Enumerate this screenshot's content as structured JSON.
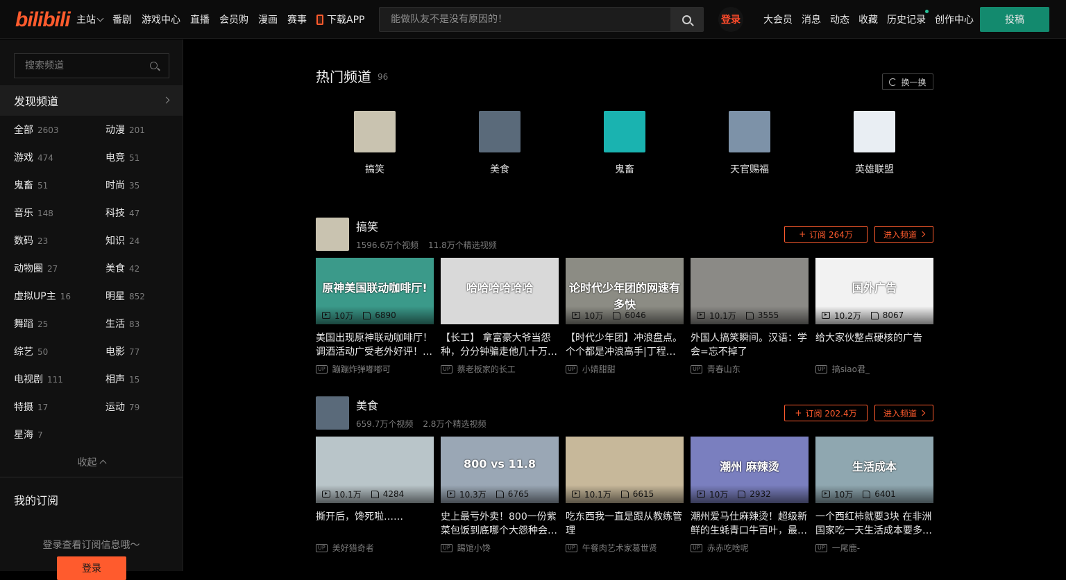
{
  "header": {
    "logo": "bilibili",
    "nav": [
      "主站",
      "番剧",
      "游戏中心",
      "直播",
      "会员购",
      "漫画",
      "赛事",
      "下载APP"
    ],
    "search_placeholder": "能做队友不是没有原因的！",
    "login": "登录",
    "right_nav": [
      "大会员",
      "消息",
      "动态",
      "收藏",
      "历史记录",
      "创作中心"
    ],
    "upload": "投稿"
  },
  "sidebar": {
    "search_placeholder": "搜索频道",
    "discover": "发现频道",
    "categories": [
      {
        "name": "全部",
        "count": "2603"
      },
      {
        "name": "动漫",
        "count": "201"
      },
      {
        "name": "游戏",
        "count": "474"
      },
      {
        "name": "电竞",
        "count": "51"
      },
      {
        "name": "鬼畜",
        "count": "51"
      },
      {
        "name": "时尚",
        "count": "35"
      },
      {
        "name": "音乐",
        "count": "148"
      },
      {
        "name": "科技",
        "count": "47"
      },
      {
        "name": "数码",
        "count": "23"
      },
      {
        "name": "知识",
        "count": "24"
      },
      {
        "name": "动物圈",
        "count": "27"
      },
      {
        "name": "美食",
        "count": "42"
      },
      {
        "name": "虚拟UP主",
        "count": "16"
      },
      {
        "name": "明星",
        "count": "852"
      },
      {
        "name": "舞蹈",
        "count": "25"
      },
      {
        "name": "生活",
        "count": "83"
      },
      {
        "name": "综艺",
        "count": "50"
      },
      {
        "name": "电影",
        "count": "77"
      },
      {
        "name": "电视剧",
        "count": "111"
      },
      {
        "name": "相声",
        "count": "15"
      },
      {
        "name": "特摄",
        "count": "17"
      },
      {
        "name": "运动",
        "count": "79"
      },
      {
        "name": "星海",
        "count": "7"
      }
    ],
    "collapse": "收起",
    "my_subscriptions": "我的订阅",
    "login_tip": "登录查看订阅信息哦～",
    "login_button": "登录"
  },
  "hot": {
    "title": "热门频道",
    "count": "96",
    "refresh": "换一换",
    "channels": [
      {
        "name": "搞笑",
        "color": "#c9c3b0"
      },
      {
        "name": "美食",
        "color": "#5a6a7a"
      },
      {
        "name": "鬼畜",
        "color": "#1ab3b0"
      },
      {
        "name": "天官赐福",
        "color": "#7d92a8"
      },
      {
        "name": "英雄联盟",
        "color": "#e9eef3"
      }
    ]
  },
  "sections": [
    {
      "name": "搞笑",
      "videos_count": "1596.6万个视频",
      "featured_count": "11.8万个精选视频",
      "subscribe": "订阅 264万",
      "enter": "进入频道",
      "avatar_color": "#c9c3b0",
      "cards": [
        {
          "title": "美国出现原神联动咖啡厅！调酒活动广受老外好评！…",
          "views": "10万",
          "likes": "6890",
          "up": "蹦蹦炸弹嘟嘟可",
          "overlay": "原神美国联动咖啡厅!",
          "color": "#3b9a8a"
        },
        {
          "title": "【长工】 拿富豪大爷当怨种，分分钟骗走他几十万…",
          "views": "",
          "likes": "",
          "up": "蔡老板家的长工",
          "overlay": "哈哈哈哈哈哈",
          "color": "#d9d9d9"
        },
        {
          "title": "【时代少年团】冲浪盘点。个个都是冲浪高手|丁程…",
          "views": "10万",
          "likes": "6046",
          "up": "小婧甜甜",
          "overlay": "论时代少年团的网速有多快",
          "color": "#8c8c84"
        },
        {
          "title": "外国人搞笑瞬间。汉语：学会=忘不掉了",
          "views": "10.1万",
          "likes": "3555",
          "up": "青春山东",
          "overlay": "",
          "color": "#8b8a86"
        },
        {
          "title": "给大家伙整点硬核的广告",
          "views": "10.2万",
          "likes": "8067",
          "up": "搞siao君_",
          "overlay": "国外广告",
          "color": "#f2f2f2"
        }
      ]
    },
    {
      "name": "美食",
      "videos_count": "659.7万个视频",
      "featured_count": "2.8万个精选视频",
      "subscribe": "订阅 202.4万",
      "enter": "进入频道",
      "avatar_color": "#5a6a7a",
      "cards": [
        {
          "title": "撕开后，馋死啦……",
          "views": "10.1万",
          "likes": "4284",
          "up": "美好猎奇者",
          "overlay": "",
          "color": "#b9c5c9"
        },
        {
          "title": "史上最亏外卖！800一份紫菜包饭到底哪个大怨种会…",
          "views": "10.3万",
          "likes": "6765",
          "up": "踢馆小馋",
          "overlay": "800 vs 11.8",
          "color": "#9aa7b5"
        },
        {
          "title": "吃东西我一直是跟从教练管理",
          "views": "10.1万",
          "likes": "6615",
          "up": "午餐肉艺术家葛世贤",
          "overlay": "",
          "color": "#c7b89a"
        },
        {
          "title": "潮州爱马仕麻辣烫！超级新鲜的生蚝青口牛百叶，最…",
          "views": "10万",
          "likes": "2932",
          "up": "赤赤吃啥呢",
          "overlay": "潮州 麻辣烫",
          "color": "#7a7fbf"
        },
        {
          "title": "一个西红柿就要3块 在非洲国家吃一天生活成本要多…",
          "views": "10万",
          "likes": "6401",
          "up": "一尾鹿-",
          "overlay": "生活成本",
          "color": "#8fa7b0"
        }
      ]
    }
  ]
}
